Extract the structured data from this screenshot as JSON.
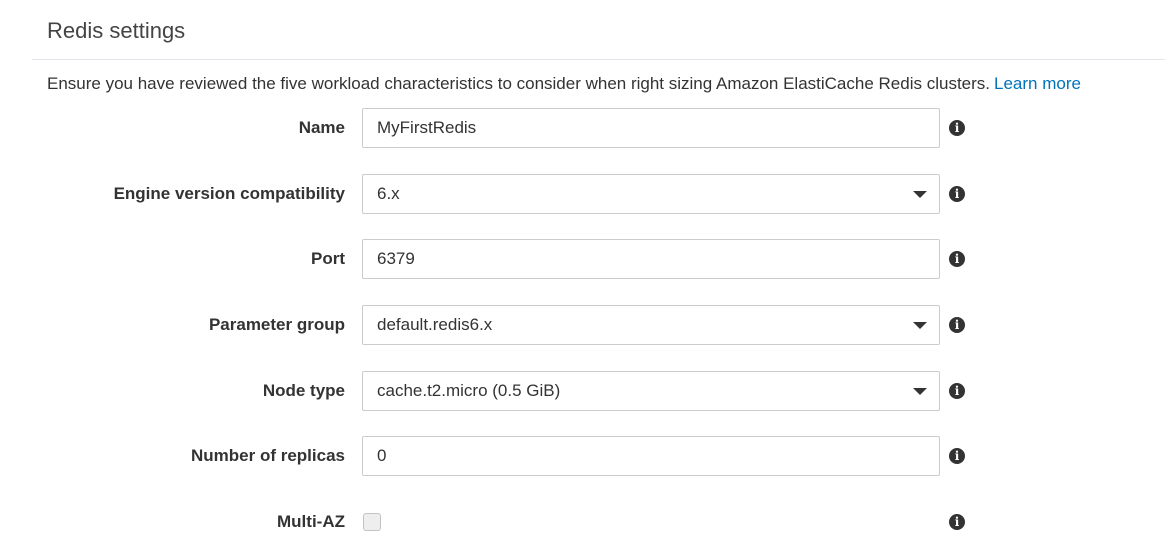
{
  "section": {
    "title": "Redis settings",
    "intro_text": "Ensure you have reviewed the five workload characteristics to consider when right sizing Amazon ElastiCache Redis clusters.",
    "learn_more": "Learn more"
  },
  "form": {
    "name": {
      "label": "Name",
      "value": "MyFirstRedis"
    },
    "engine_version": {
      "label": "Engine version compatibility",
      "value": "6.x"
    },
    "port": {
      "label": "Port",
      "value": "6379"
    },
    "parameter_group": {
      "label": "Parameter group",
      "value": "default.redis6.x"
    },
    "node_type": {
      "label": "Node type",
      "value": "cache.t2.micro (0.5 GiB)"
    },
    "replicas": {
      "label": "Number of replicas",
      "value": "0"
    },
    "multi_az": {
      "label": "Multi-AZ",
      "checked": false
    }
  },
  "icons": {
    "info": "info-icon",
    "dropdown": "caret-down-icon"
  },
  "colors": {
    "link": "#0073bb",
    "text": "#333333",
    "border": "#c8cccc"
  }
}
